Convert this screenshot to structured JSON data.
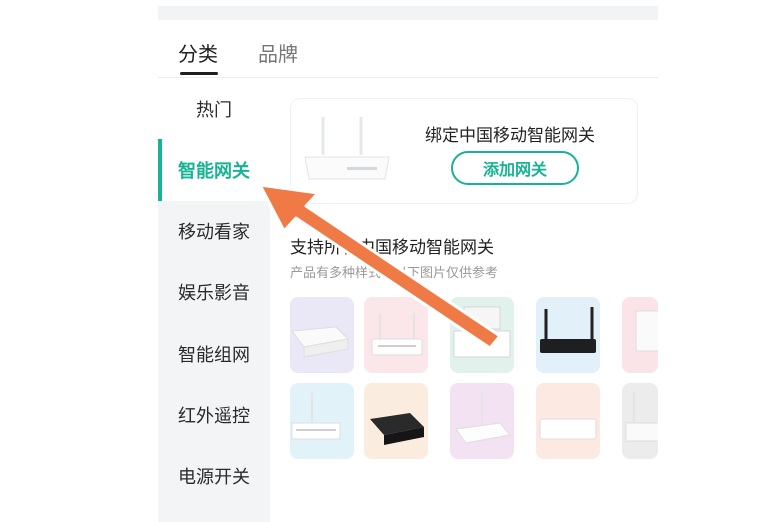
{
  "tabs": {
    "category": "分类",
    "brand": "品牌"
  },
  "sidebar": {
    "items": [
      {
        "label": "热门"
      },
      {
        "label": "智能网关"
      },
      {
        "label": "移动看家"
      },
      {
        "label": "娱乐影音"
      },
      {
        "label": "智能组网"
      },
      {
        "label": "红外遥控"
      },
      {
        "label": "电源开关"
      }
    ]
  },
  "main": {
    "bind_card": {
      "title": "绑定中国移动智能网关",
      "button_label": "添加网关"
    },
    "support_title": "支持所有中国移动智能网关",
    "support_subtitle": "产品有多种样式，以下图片仅供参考"
  },
  "colors": {
    "accent": "#18b394",
    "arrow": "#f07a45"
  }
}
